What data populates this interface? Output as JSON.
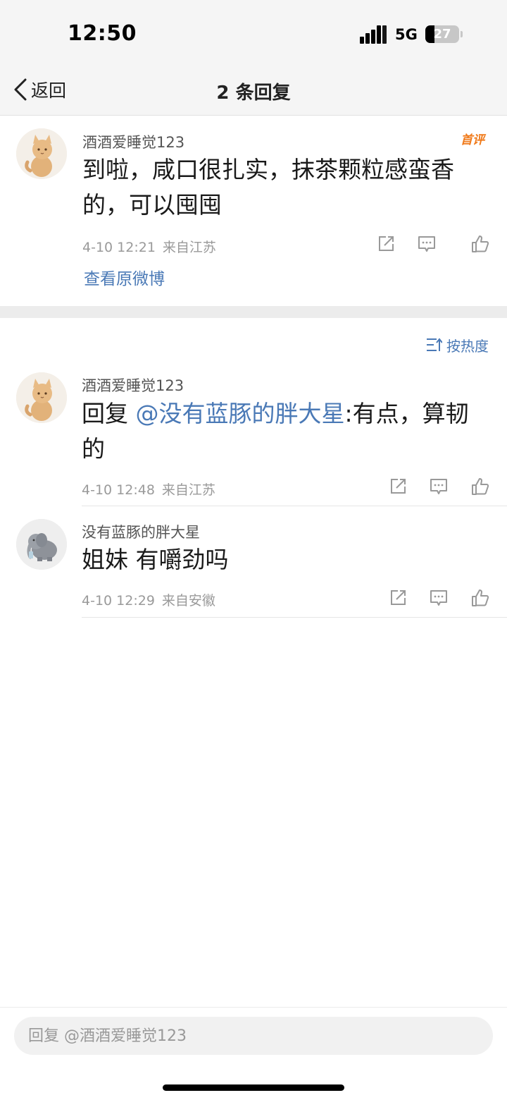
{
  "status_bar": {
    "time": "12:50",
    "network": "5G",
    "battery": "27"
  },
  "nav": {
    "back_label": "返回",
    "title": "2 条回复"
  },
  "post": {
    "username": "酒酒爱睡觉123",
    "badge": "首评",
    "content": "到啦，咸口很扎实，抹茶颗粒感蛮香的，可以囤囤",
    "date": "4-10 12:21",
    "location": "来自江苏",
    "view_original": "查看原微博"
  },
  "sort": {
    "label": "按热度"
  },
  "replies": [
    {
      "username": "酒酒爱睡觉123",
      "reply_prefix": "回复 ",
      "mention": "@没有蓝豚的胖大星",
      "content_after": ":有点，算韧的",
      "date": "4-10 12:48",
      "location": "来自江苏"
    },
    {
      "username": "没有蓝豚的胖大星",
      "content": "姐妹 有嚼劲吗",
      "date": "4-10 12:29",
      "location": "来自安徽"
    }
  ],
  "composer": {
    "placeholder": "回复 @酒酒爱睡觉123"
  },
  "icons": {
    "back": "chevron-left-icon",
    "share": "share-icon",
    "comment": "comment-icon",
    "like": "thumbs-up-icon",
    "sort": "sort-icon",
    "signal": "signal-icon",
    "battery": "battery-icon"
  },
  "colors": {
    "link": "#4a79b6",
    "badge": "#f07a1a",
    "background": "#f5f5f5"
  }
}
